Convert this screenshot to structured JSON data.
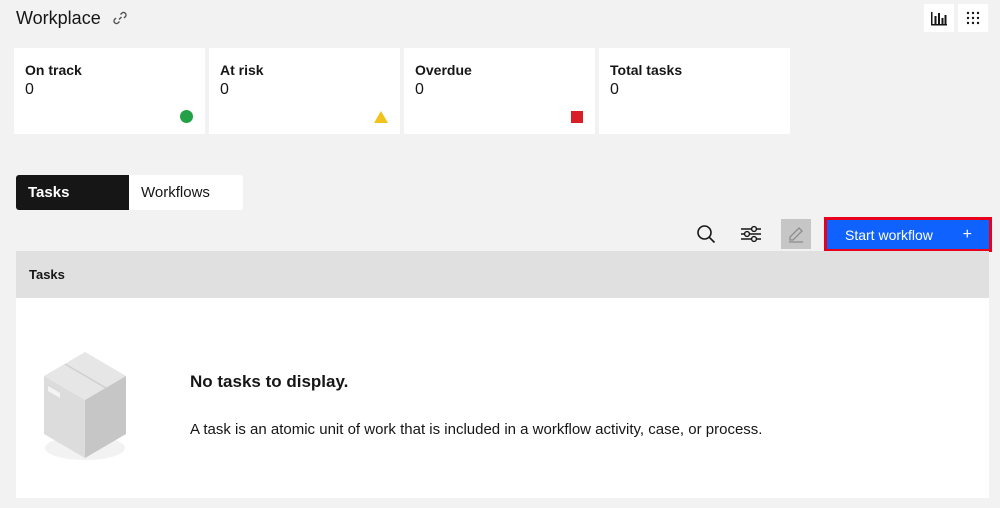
{
  "header": {
    "title": "Workplace",
    "link_icon": "link-icon"
  },
  "top_actions": [
    {
      "icon": "chart-bar-icon"
    },
    {
      "icon": "grid-dots-icon"
    }
  ],
  "tiles": [
    {
      "label": "On track",
      "value": "0",
      "indicator": "green-circle",
      "color": "#24a148"
    },
    {
      "label": "At risk",
      "value": "0",
      "indicator": "yellow-triangle",
      "color": "#f1c21b"
    },
    {
      "label": "Overdue",
      "value": "0",
      "indicator": "red-square",
      "color": "#da1e28"
    },
    {
      "label": "Total tasks",
      "value": "0"
    }
  ],
  "tabs": [
    {
      "label": "Tasks",
      "selected": true
    },
    {
      "label": "Workflows",
      "selected": false
    }
  ],
  "toolbar": {
    "search_icon": "search-icon",
    "filter_icon": "sliders-icon",
    "edit_icon": "pencil-icon",
    "start_label": "Start workflow",
    "start_plus": "+",
    "accent": "#0f62fe",
    "highlight": "#e8001c"
  },
  "table": {
    "header": "Tasks"
  },
  "empty_state": {
    "title": "No tasks to display.",
    "description": "A task is an atomic unit of work that is included in a workflow activity, case, or process.",
    "illustration": "box-icon"
  }
}
